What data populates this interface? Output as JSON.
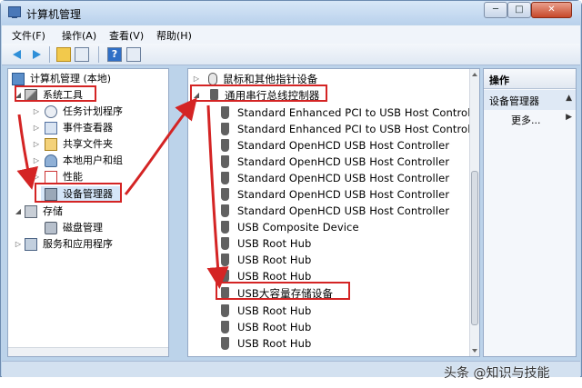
{
  "window": {
    "title": "计算机管理"
  },
  "window_controls": {
    "minimize": "─",
    "maximize": "□",
    "close": "✕"
  },
  "menu": [
    {
      "label": "文件(F)"
    },
    {
      "label": "操作(A)"
    },
    {
      "label": "查看(V)"
    },
    {
      "label": "帮助(H)"
    }
  ],
  "toolbar": {
    "help_glyph": "?"
  },
  "tree": {
    "root": "计算机管理 (本地)",
    "system_tools": "系统工具",
    "task_scheduler": "任务计划程序",
    "event_viewer": "事件查看器",
    "shared_folders": "共享文件夹",
    "local_users": "本地用户和组",
    "performance": "性能",
    "device_manager": "设备管理器",
    "storage": "存储",
    "disk_management": "磁盘管理",
    "services": "服务和应用程序"
  },
  "devices": {
    "mice": "鼠标和其他指针设备",
    "usb_controllers": "通用串行总线控制器",
    "items": [
      "Standard Enhanced PCI to USB Host Controller",
      "Standard Enhanced PCI to USB Host Controller",
      "Standard OpenHCD USB Host Controller",
      "Standard OpenHCD USB Host Controller",
      "Standard OpenHCD USB Host Controller",
      "Standard OpenHCD USB Host Controller",
      "Standard OpenHCD USB Host Controller",
      "USB Composite Device",
      "USB Root Hub",
      "USB Root Hub",
      "USB Root Hub",
      "USB大容量存储设备",
      "USB Root Hub",
      "USB Root Hub",
      "USB Root Hub"
    ]
  },
  "actions": {
    "header": "操作",
    "selected": "设备管理器",
    "more": "更多..."
  },
  "watermark": "头条 @知识与技能",
  "colors": {
    "annotation": "#d42424",
    "accent": "#2f8fd8"
  }
}
